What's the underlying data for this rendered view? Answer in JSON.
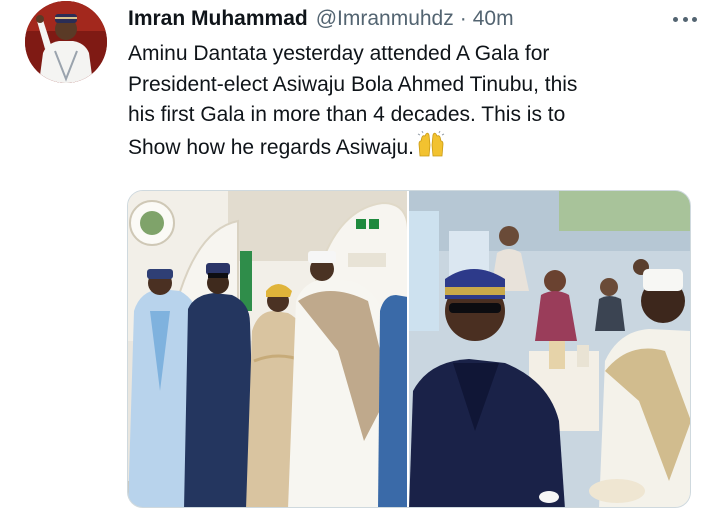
{
  "tweet": {
    "author_name": "Imran Muhammad",
    "handle": "@Imranmuhdz",
    "separator": "·",
    "timestamp": "40m",
    "text_lines": [
      "Aminu Dantata yesterday attended A Gala for",
      "President-elect Asiwaju Bola Ahmed Tinubu, this",
      "his first Gala in more than 4 decades. This is to",
      "Show how he regards Asiwaju."
    ],
    "emoji": "raising-hands-icon"
  },
  "icons": {
    "more": "more-options-icon",
    "avatar": "avatar",
    "emoji": "raising-hands-icon"
  },
  "colors": {
    "text": "#0f1419",
    "secondary": "#536471",
    "border": "#cfd9de",
    "emoji": "#f2c230"
  }
}
